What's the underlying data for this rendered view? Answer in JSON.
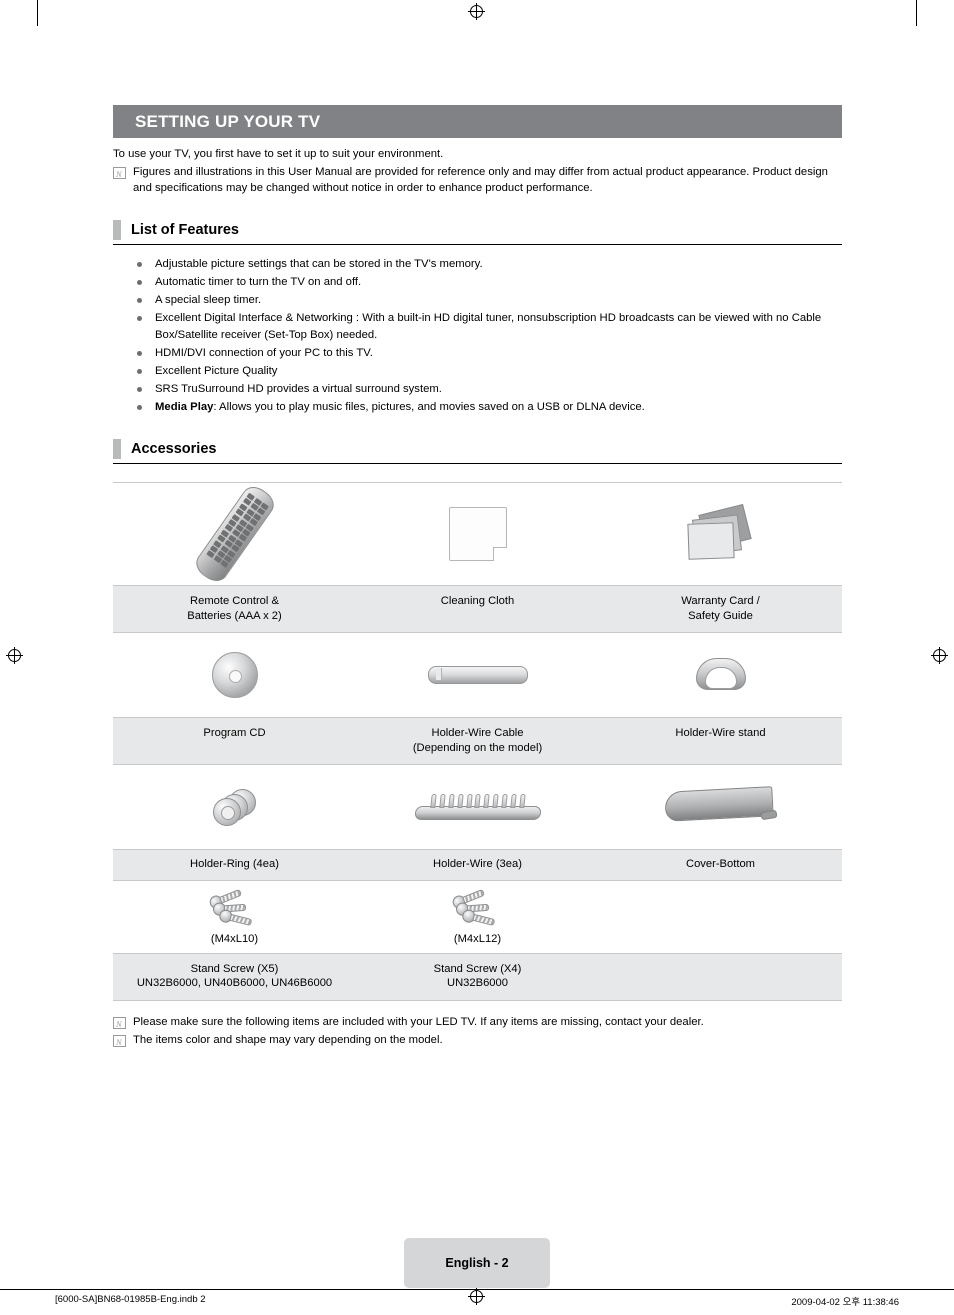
{
  "chapter": {
    "title": "SETTING UP YOUR TV"
  },
  "intro": {
    "line": "To use your TV, you first have to set it up to suit your environment.",
    "note": "Figures and illustrations in this User Manual are provided for reference only and may differ from actual product appearance. Product design and specifications may be changed without notice in order to enhance product performance."
  },
  "sections": {
    "features": {
      "title": "List of Features",
      "items": [
        {
          "text": "Adjustable picture settings that can be stored in the TV's memory.",
          "bold_prefix": ""
        },
        {
          "text": "Automatic timer to turn the TV on and off.",
          "bold_prefix": ""
        },
        {
          "text": "A special sleep timer.",
          "bold_prefix": ""
        },
        {
          "text": "Excellent Digital Interface & Networking : With a built-in HD digital tuner, nonsubscription HD broadcasts can be viewed with no Cable Box/Satellite receiver (Set-Top Box) needed.",
          "bold_prefix": ""
        },
        {
          "text": "HDMI/DVI connection of your PC to this TV.",
          "bold_prefix": ""
        },
        {
          "text": "Excellent Picture Quality",
          "bold_prefix": ""
        },
        {
          "text": "SRS TruSurround HD provides a virtual surround system.",
          "bold_prefix": ""
        },
        {
          "text": ": Allows you to play music files, pictures, and movies saved on a USB or DLNA device.",
          "bold_prefix": "Media Play"
        }
      ]
    },
    "accessories": {
      "title": "Accessories",
      "rows": [
        {
          "items": [
            {
              "icon": "remote-control",
              "label": "Remote Control &\nBatteries (AAA x 2)"
            },
            {
              "icon": "cleaning-cloth",
              "label": "Cleaning Cloth"
            },
            {
              "icon": "warranty-card",
              "label": "Warranty Card /\nSafety Guide"
            }
          ]
        },
        {
          "items": [
            {
              "icon": "program-cd",
              "label": "Program CD"
            },
            {
              "icon": "holder-wire-cable",
              "label": "Holder-Wire Cable\n(Depending on the model)"
            },
            {
              "icon": "holder-wire-stand",
              "label": "Holder-Wire stand"
            }
          ]
        },
        {
          "items": [
            {
              "icon": "holder-ring",
              "label": "Holder-Ring (4ea)"
            },
            {
              "icon": "holder-wire",
              "label": "Holder-Wire (3ea)"
            },
            {
              "icon": "cover-bottom",
              "label": "Cover-Bottom"
            }
          ]
        }
      ],
      "screw_row": {
        "captions": [
          "(M4xL10)",
          "(M4xL12)",
          ""
        ],
        "labels": [
          "Stand Screw (X5)\nUN32B6000, UN40B6000, UN46B6000",
          "Stand Screw (X4)\nUN32B6000",
          ""
        ]
      }
    }
  },
  "bottom_notes": [
    "Please make sure the following items are included with your LED TV. If any items are missing, contact your dealer.",
    "The items color and shape may vary depending on the model."
  ],
  "footer": {
    "page_tag": "English - 2",
    "left": "[6000-SA]BN68-01985B-Eng.indb   2",
    "right": "2009-04-02   오후 11:38:46"
  }
}
